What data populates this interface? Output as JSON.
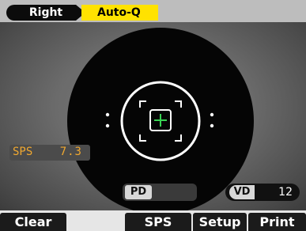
{
  "header": {
    "eye": "Right",
    "mode": "Auto-Q"
  },
  "readout": {
    "sps_label": "SPS",
    "sps_value": "7.3"
  },
  "measures": {
    "pd_label": "PD",
    "pd_value": "",
    "vd_label": "VD",
    "vd_value": "12"
  },
  "buttons": {
    "clear": "Clear",
    "sps": "SPS",
    "setup": "Setup",
    "print": "Print"
  },
  "colors": {
    "mode_tab": "#ffe200",
    "reticle_center": "#39d353",
    "sps_text": "#f0a830"
  }
}
